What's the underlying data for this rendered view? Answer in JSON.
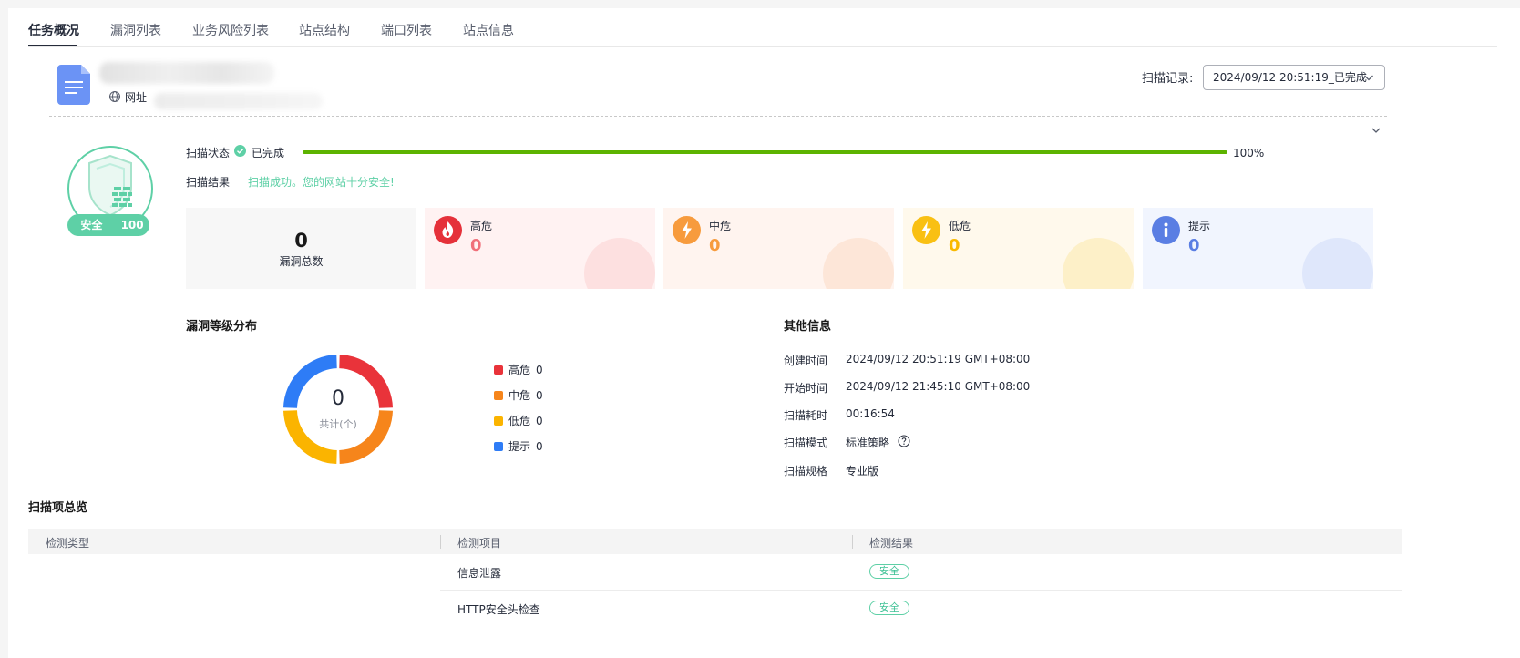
{
  "tabs": [
    {
      "label": "任务概况",
      "active": true
    },
    {
      "label": "漏洞列表",
      "active": false
    },
    {
      "label": "业务风险列表",
      "active": false
    },
    {
      "label": "站点结构",
      "active": false
    },
    {
      "label": "端口列表",
      "active": false
    },
    {
      "label": "站点信息",
      "active": false
    }
  ],
  "site": {
    "url_label": "网址"
  },
  "record": {
    "label": "扫描记录:",
    "value": "2024/09/12 20:51:19_已完成"
  },
  "score": {
    "level": "安全",
    "points": "100分"
  },
  "status": {
    "status_label": "扫描状态",
    "status_value": "已完成",
    "progress_percent": 100,
    "progress_text": "100%",
    "result_label": "扫描结果",
    "result_text": "扫描成功。您的网站十分安全!"
  },
  "summary": {
    "total": {
      "value": "0",
      "label": "漏洞总数"
    },
    "cards": [
      {
        "label": "高危",
        "value": "0",
        "color": "#e5313a",
        "icon": "flame-icon"
      },
      {
        "label": "中危",
        "value": "0",
        "color": "#f79b3d",
        "icon": "lightning-icon"
      },
      {
        "label": "低危",
        "value": "0",
        "color": "#f9c013",
        "icon": "lightning-icon"
      },
      {
        "label": "提示",
        "value": "0",
        "color": "#5a7ee3",
        "icon": "info-icon"
      }
    ]
  },
  "distribution": {
    "title": "漏洞等级分布",
    "center_value": "0",
    "center_caption": "共计(个)",
    "legend": [
      {
        "label": "高危",
        "value": "0",
        "color": "#e9333a"
      },
      {
        "label": "中危",
        "value": "0",
        "color": "#f6851b"
      },
      {
        "label": "低危",
        "value": "0",
        "color": "#fbb400"
      },
      {
        "label": "提示",
        "value": "0",
        "color": "#2e7cf6"
      }
    ]
  },
  "other_info": {
    "title": "其他信息",
    "rows": [
      {
        "key": "创建时间",
        "value": "2024/09/12 20:51:19 GMT+08:00"
      },
      {
        "key": "开始时间",
        "value": "2024/09/12 21:45:10 GMT+08:00"
      },
      {
        "key": "扫描耗时",
        "value": "00:16:54"
      },
      {
        "key": "扫描模式",
        "value": "标准策略"
      },
      {
        "key": "扫描规格",
        "value": "专业版"
      }
    ]
  },
  "scan_items": {
    "title": "扫描项总览",
    "columns": [
      "检测类型",
      "检测项目",
      "检测结果"
    ],
    "rows": [
      {
        "item": "信息泄露",
        "result": "安全"
      },
      {
        "item": "HTTP安全头检查",
        "result": "安全"
      }
    ]
  },
  "colors": {
    "accent_green": "#5ed0a6",
    "progress_green": "#5cb300"
  }
}
